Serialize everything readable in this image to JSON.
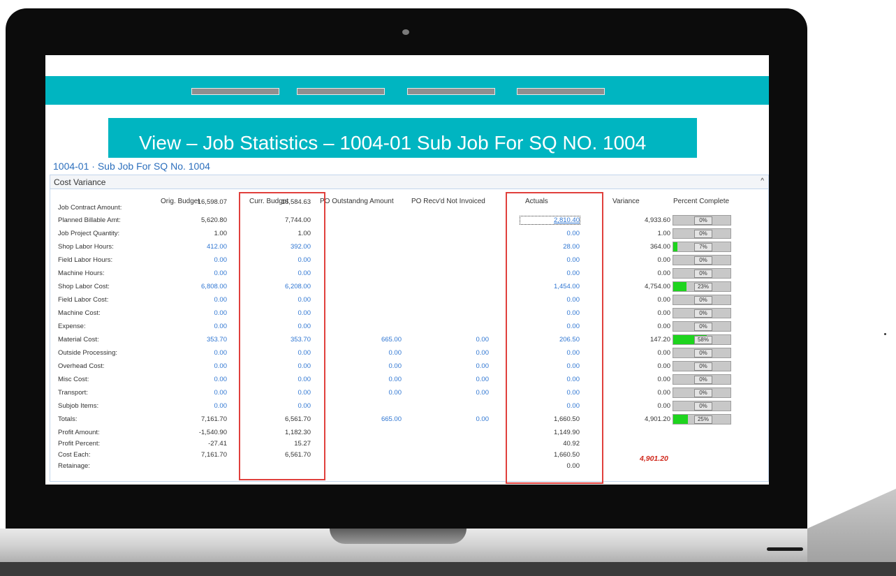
{
  "banner": {
    "title": "View – Job Statistics – 1004-01 Sub Job For SQ NO. 1004"
  },
  "job_title": "1004-01 · Sub Job For SQ No. 1004",
  "panel": {
    "title": "Cost Variance"
  },
  "columns": {
    "orig": "Orig. Budget",
    "curr": "Curr. Budget",
    "po_out": "PO Outstandng Amount",
    "po_recv": "PO Recv'd Not Invoiced",
    "actuals": "Actuals",
    "variance": "Variance",
    "pct": "Percent Complete"
  },
  "rows": [
    {
      "label": "Job Contract Amount:",
      "orig": "16,598.07",
      "curr": "16,584.63"
    },
    {
      "label": "Planned Billable Amt:",
      "orig": "5,620.80",
      "curr": "7,744.00",
      "actual": "2,810.40",
      "variance": "4,933.60",
      "pct": "0%",
      "pct_value": 0
    },
    {
      "label": "Job Project Quantity:",
      "orig": "1.00",
      "curr": "1.00",
      "actual": "0.00",
      "variance": "1.00",
      "pct": "0%",
      "pct_value": 0
    },
    {
      "label": "Shop Labor Hours:",
      "orig": "412.00",
      "curr": "392.00",
      "actual": "28.00",
      "variance": "364.00",
      "pct": "7%",
      "pct_value": 7
    },
    {
      "label": "Field Labor Hours:",
      "orig": "0.00",
      "curr": "0.00",
      "actual": "0.00",
      "variance": "0.00",
      "pct": "0%",
      "pct_value": 0
    },
    {
      "label": "Machine Hours:",
      "orig": "0.00",
      "curr": "0.00",
      "actual": "0.00",
      "variance": "0.00",
      "pct": "0%",
      "pct_value": 0
    },
    {
      "label": "Shop Labor Cost:",
      "orig": "6,808.00",
      "curr": "6,208.00",
      "actual": "1,454.00",
      "variance": "4,754.00",
      "pct": "23%",
      "pct_value": 23
    },
    {
      "label": "Field Labor Cost:",
      "orig": "0.00",
      "curr": "0.00",
      "actual": "0.00",
      "variance": "0.00",
      "pct": "0%",
      "pct_value": 0
    },
    {
      "label": "Machine Cost:",
      "orig": "0.00",
      "curr": "0.00",
      "actual": "0.00",
      "variance": "0.00",
      "pct": "0%",
      "pct_value": 0
    },
    {
      "label": "Expense:",
      "orig": "0.00",
      "curr": "0.00",
      "actual": "0.00",
      "variance": "0.00",
      "pct": "0%",
      "pct_value": 0
    },
    {
      "label": "Material Cost:",
      "orig": "353.70",
      "curr": "353.70",
      "po_out": "665.00",
      "po_recv": "0.00",
      "actual": "206.50",
      "variance": "147.20",
      "pct": "58%",
      "pct_value": 58
    },
    {
      "label": "Outside Processing:",
      "orig": "0.00",
      "curr": "0.00",
      "po_out": "0.00",
      "po_recv": "0.00",
      "actual": "0.00",
      "variance": "0.00",
      "pct": "0%",
      "pct_value": 0
    },
    {
      "label": "Overhead Cost:",
      "orig": "0.00",
      "curr": "0.00",
      "po_out": "0.00",
      "po_recv": "0.00",
      "actual": "0.00",
      "variance": "0.00",
      "pct": "0%",
      "pct_value": 0
    },
    {
      "label": "Misc Cost:",
      "orig": "0.00",
      "curr": "0.00",
      "po_out": "0.00",
      "po_recv": "0.00",
      "actual": "0.00",
      "variance": "0.00",
      "pct": "0%",
      "pct_value": 0
    },
    {
      "label": "Transport:",
      "orig": "0.00",
      "curr": "0.00",
      "po_out": "0.00",
      "po_recv": "0.00",
      "actual": "0.00",
      "variance": "0.00",
      "pct": "0%",
      "pct_value": 0
    },
    {
      "label": "Subjob Items:",
      "orig": "0.00",
      "curr": "0.00",
      "actual": "0.00",
      "variance": "0.00",
      "pct": "0%",
      "pct_value": 0
    },
    {
      "label": "Totals:",
      "orig": "7,161.70",
      "curr": "6,561.70",
      "po_out": "665.00",
      "po_recv": "0.00",
      "actual": "1,660.50",
      "variance": "4,901.20",
      "pct": "25%",
      "pct_value": 25
    },
    {
      "label": "Profit Amount:",
      "orig": "-1,540.90",
      "curr": "1,182.30",
      "actual": "1,149.90"
    },
    {
      "label": "Profit Percent:",
      "orig": "-27.41",
      "curr": "15.27",
      "actual": "40.92"
    },
    {
      "label": "Cost Each:",
      "orig": "7,161.70",
      "curr": "6,561.70",
      "actual": "1,660.50"
    },
    {
      "label": "Retainage:",
      "actual": "0.00"
    }
  ],
  "cost_each_variance": "4,901.20",
  "colors": {
    "accent": "#00b5c1",
    "link": "#2f76d2",
    "highlight_box": "#e0403c",
    "progress": "#1ed41e",
    "variance_red": "#d0281c"
  }
}
